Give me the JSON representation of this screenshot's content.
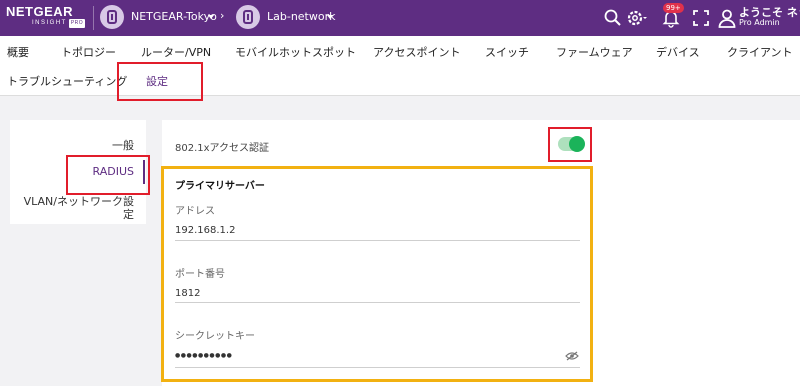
{
  "header": {
    "logo_main": "NETGEAR",
    "logo_sub": "INSIGHT",
    "logo_tag": "PRO",
    "org_name": "NETGEAR-Tokyo",
    "chevron": "›",
    "location_name": "Lab-network",
    "notification_badge": "99+",
    "welcome_text": "ようこそ ネッ",
    "role_text": "Pro Admin",
    "icons": [
      "search-icon",
      "gear-icon",
      "bell-icon",
      "expand-icon",
      "user-icon"
    ]
  },
  "nav": {
    "row1": [
      "概要",
      "トポロジー",
      "ルーター/VPN",
      "モバイルホットスポット",
      "アクセスポイント",
      "スイッチ",
      "ファームウェア",
      "デバイス",
      "クライアント"
    ],
    "row2": [
      "トラブルシューティング",
      "設定"
    ]
  },
  "sidebar": {
    "items": [
      "一般",
      "RADIUS",
      "VLAN/ネットワーク設",
      "定"
    ],
    "active": "RADIUS"
  },
  "form": {
    "auth_label": "802.1xアクセス認証",
    "auth_enabled": true,
    "section_title": "プライマリサーバー",
    "address_label": "アドレス",
    "address_value": "192.168.1.2",
    "port_label": "ポート番号",
    "port_value": "1812",
    "secret_label": "シークレットキー",
    "secret_value": "●●●●●●●●●●"
  },
  "colors": {
    "brand": "#5e2d82",
    "toggle_on": "#1bb35a",
    "highlight_red": "#e11d2b",
    "highlight_yellow": "#f2b111"
  }
}
